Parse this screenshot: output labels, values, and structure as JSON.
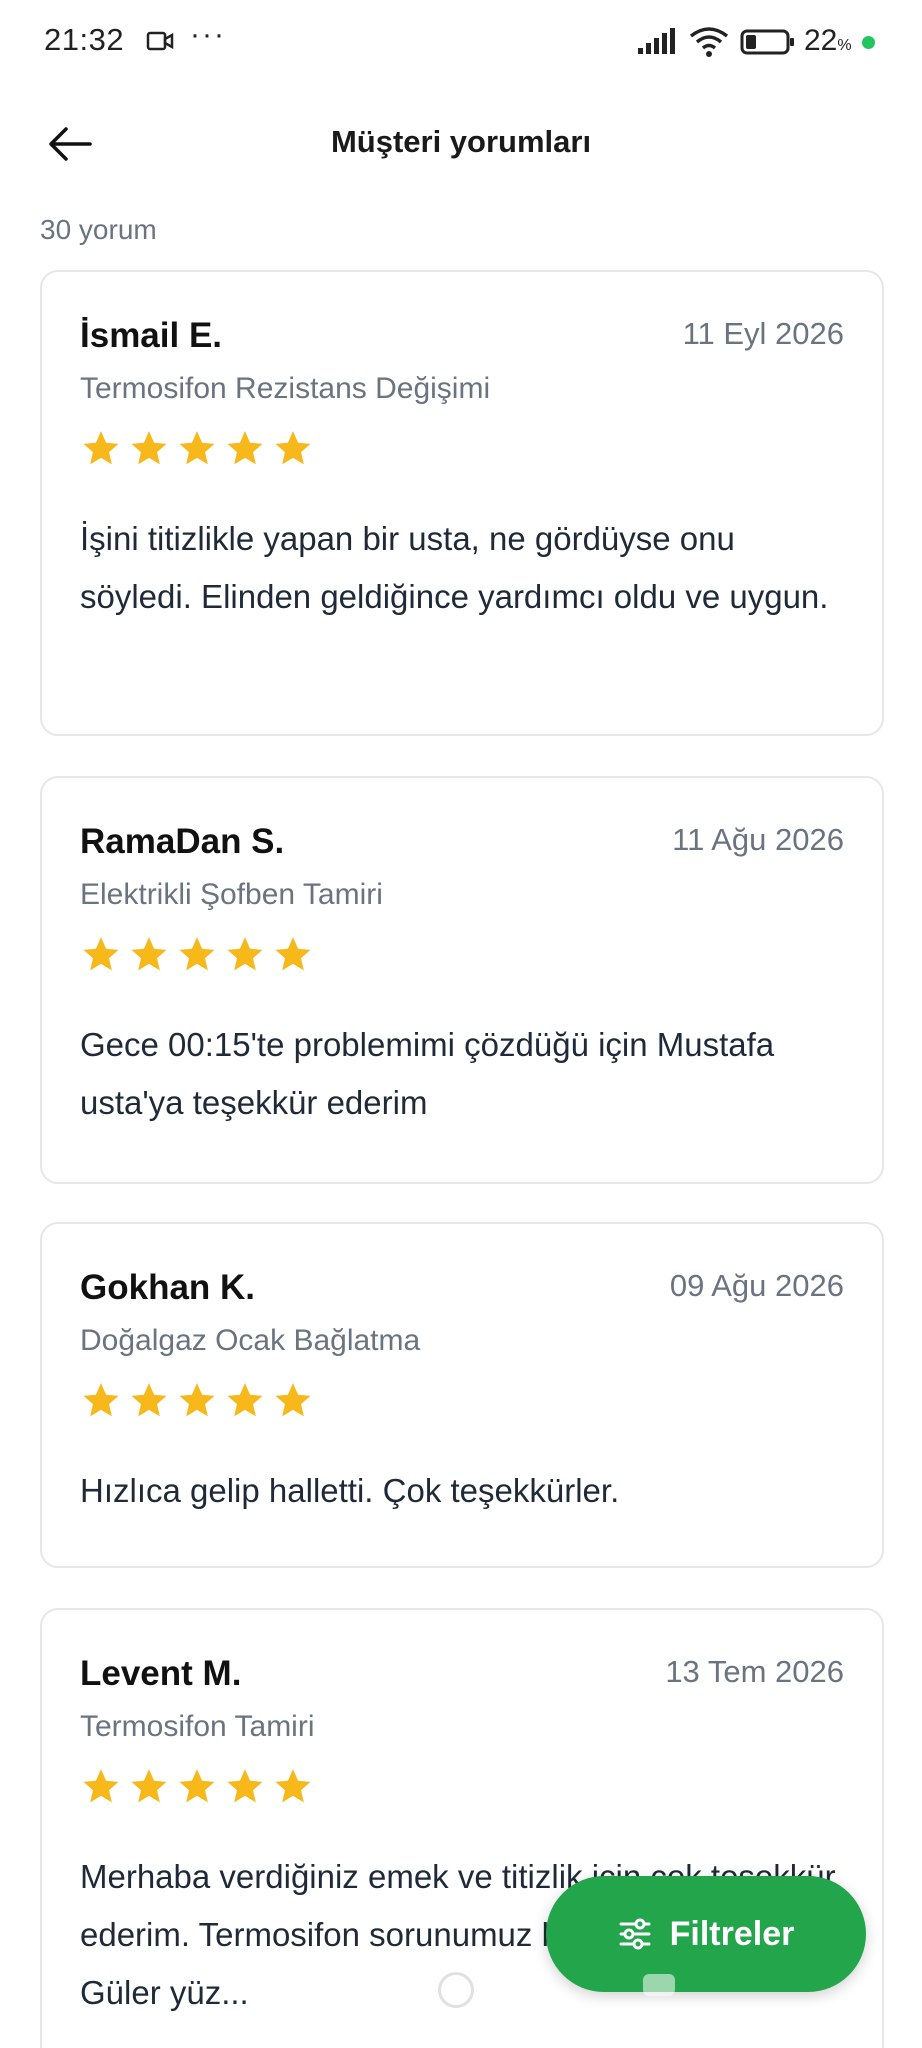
{
  "status_bar": {
    "time": "21:32",
    "more": "···",
    "battery_value": "22",
    "battery_unit": "%",
    "icons": [
      "video-icon",
      "signal-icon",
      "wifi-icon",
      "battery-icon"
    ]
  },
  "header": {
    "title": "Müşteri yorumları",
    "back_icon": "back-arrow-icon"
  },
  "summary": {
    "count_text": "30 yorum"
  },
  "reviews": [
    {
      "name": "İsmail E.",
      "date": "11 Eyl 2026",
      "service": "Termosifon Rezistans Değişimi",
      "rating": 5,
      "text": "İşini titizlikle yapan bir usta, ne gördüyse onu söyledi. Elinden geldiğince yardımcı oldu ve uygun."
    },
    {
      "name": "RamaDan S.",
      "date": "11 Ağu 2026",
      "service": "Elektrikli Şofben Tamiri",
      "rating": 5,
      "text": "Gece 00:15'te problemimi çözdüğü için Mustafa usta'ya teşekkür ederim"
    },
    {
      "name": "Gokhan K.",
      "date": "09 Ağu 2026",
      "service": "Doğalgaz Ocak Bağlatma",
      "rating": 5,
      "text": "Hızlıca gelip halletti. Çok teşekkürler."
    },
    {
      "name": "Levent M.",
      "date": "13 Tem 2026",
      "service": "Termosifon Tamiri",
      "rating": 5,
      "text": "Merhaba verdiğiniz emek ve titizlik için çok teşekkür ederim. Termosifon sorunumuz kısa sürede çözüldü. Güler yüz..."
    }
  ],
  "filter": {
    "label": "Filtreler",
    "icon": "sliders-icon"
  },
  "colors": {
    "accent": "#22a54b",
    "star": "#f6b81a",
    "muted": "#6b7280",
    "border": "#e5e7eb"
  }
}
